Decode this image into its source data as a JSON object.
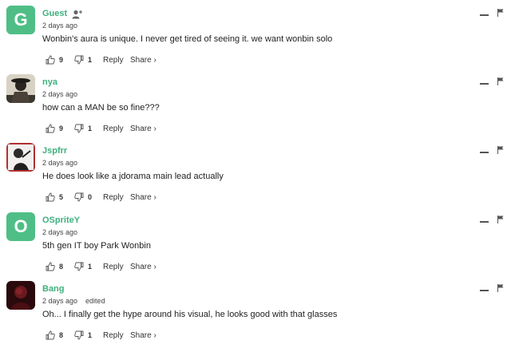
{
  "comments": [
    {
      "username": "Guest",
      "avatar_type": "letter",
      "avatar_letter": "G",
      "avatar_color": "#4fbe86",
      "guest_icon": "add-user-icon",
      "timestamp": "2 days ago",
      "edited": "",
      "text": "Wonbin's aura is unique. I never get tired of seeing it. we want wonbin solo",
      "upvotes": "9",
      "downvotes": "1",
      "reply_label": "Reply",
      "share_label": "Share ›"
    },
    {
      "username": "nya",
      "avatar_type": "image",
      "avatar_letter": "",
      "timestamp": "2 days ago",
      "edited": "",
      "text": "how can a MAN be so fine???",
      "upvotes": "9",
      "downvotes": "1",
      "reply_label": "Reply",
      "share_label": "Share ›"
    },
    {
      "username": "Jspfrr",
      "avatar_type": "image",
      "avatar_letter": "",
      "timestamp": "2 days ago",
      "edited": "",
      "text": "He does look like a jdorama main lead actually",
      "upvotes": "5",
      "downvotes": "0",
      "reply_label": "Reply",
      "share_label": "Share ›"
    },
    {
      "username": "OSpriteY",
      "avatar_type": "letter",
      "avatar_letter": "O",
      "avatar_color": "#4fbe86",
      "timestamp": "2 days ago",
      "edited": "",
      "text": "5th gen IT boy Park Wonbin",
      "upvotes": "8",
      "downvotes": "1",
      "reply_label": "Reply",
      "share_label": "Share ›"
    },
    {
      "username": "Bang",
      "avatar_type": "image",
      "avatar_letter": "",
      "timestamp": "2 days ago",
      "edited": "edited",
      "text": "Oh... I finally get the hype around his visual, he looks good with that glasses",
      "upvotes": "8",
      "downvotes": "1",
      "reply_label": "Reply",
      "share_label": "Share ›"
    }
  ],
  "colors": {
    "username": "#3fb07d",
    "avatar_bg": "#4fbe86",
    "text": "#222222"
  }
}
